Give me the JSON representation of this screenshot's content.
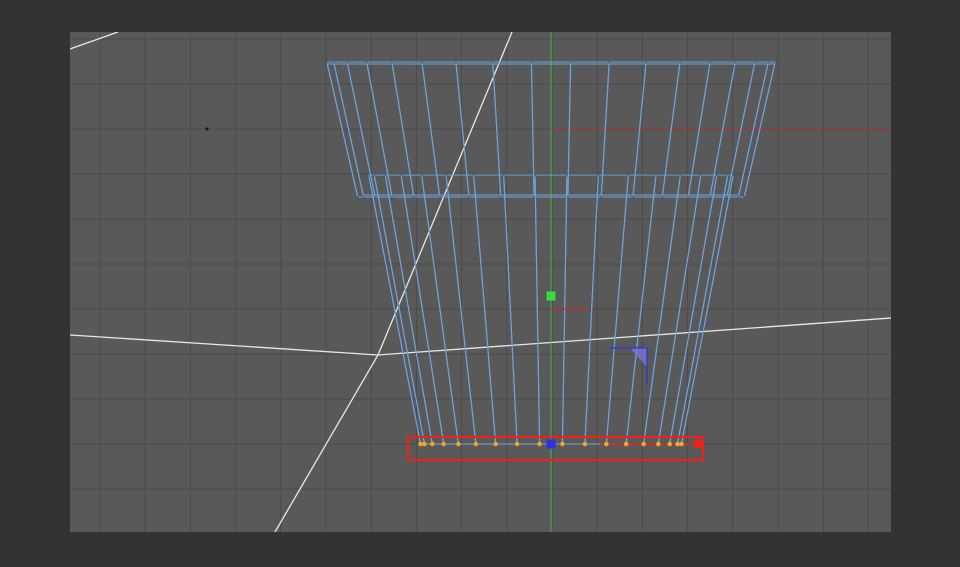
{
  "viewport": {
    "background": "#595959",
    "frame": "#333333",
    "grid_color": "#4b4b4b",
    "wire_color": "#6fa3dc",
    "edge_color": "#e8e8e0",
    "point_color": "#f5a623",
    "selection_color": "#ff1a1a",
    "axis_y_color": "#3ddc3d",
    "axis_x_color": "#c82828",
    "axis_z_color": "#3030e0"
  },
  "icons": [
    "object-axis-icon",
    "move-gizmo-icon",
    "plane-gizmo-icon"
  ]
}
